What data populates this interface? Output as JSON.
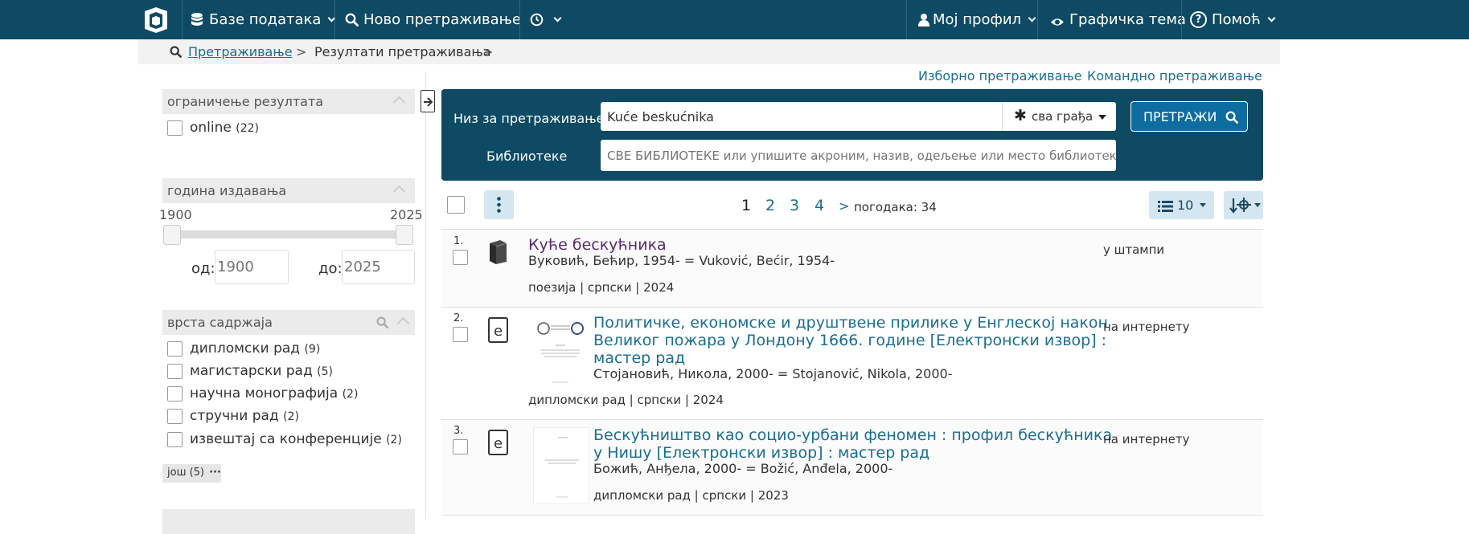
{
  "navbar": {
    "databases_label": "Базе података",
    "new_search_label": "Ново претраживање",
    "profile_label": "Мој профил",
    "theme_label": "Графичка тема",
    "help_label": "Помоћ"
  },
  "breadcrumb": {
    "search_link": "Претраживање",
    "separator": ">",
    "results": "Резултати претраживања"
  },
  "links": {
    "selective_search": "Изборно претраживање",
    "command_search": "Командно претраживање"
  },
  "search": {
    "query_label": "Низ за претраживање",
    "query_value": "Kuće beskućnika",
    "material_select": "сва грађа",
    "libraries_label": "Библиотеке",
    "libraries_placeholder": "СВЕ БИБЛИОТЕКЕ или упишите акроним, назив, одељење или место библиотеке",
    "submit_label": "ПРЕТРАЖИ"
  },
  "facets": {
    "limit": {
      "title": "ограничење резултата",
      "items": [
        {
          "label": "online",
          "count": "(22)"
        }
      ]
    },
    "year": {
      "title": "година издавања",
      "min_label": "1900",
      "max_label": "2025",
      "from_label": "од:",
      "to_label": "до:",
      "from_placeholder": "1900",
      "to_placeholder": "2025"
    },
    "content_type": {
      "title": "врста садржаја",
      "items": [
        {
          "label": "дипломски рад",
          "count": "(9)"
        },
        {
          "label": "магистарски рад",
          "count": "(5)"
        },
        {
          "label": "научна монографија",
          "count": "(2)"
        },
        {
          "label": "стручни рад",
          "count": "(2)"
        },
        {
          "label": "извештај са конференције",
          "count": "(2)"
        }
      ],
      "more_label": "још (5)"
    }
  },
  "pagination": {
    "pages": [
      "1",
      "2",
      "3",
      "4"
    ],
    "current": "1",
    "next": ">",
    "hits_label": "погодака: 34",
    "page_size": "10"
  },
  "results": [
    {
      "num": "1.",
      "title": "Куће бескућника",
      "author": "Вуковић, Бећир, 1954- = Vuković, Bećir, 1954-",
      "meta": "поезија | српски | 2024",
      "availability": "у штампи",
      "icon": "book-icon"
    },
    {
      "num": "2.",
      "title_lines": [
        "Политичке, економске и друштвене прилике у Енглеској након",
        "Великог пожара у Лондону 1666. године [Електронски извор] :",
        "мастер рад"
      ],
      "author": "Стојановић, Никола, 2000- = Stojanović, Nikola, 2000-",
      "meta": "дипломски рад | српски | 2024",
      "availability": "на интернету",
      "icon": "e-resource-icon"
    },
    {
      "num": "3.",
      "title_lines": [
        "Бескућништво као социо-урбани феномен : профил бескућника",
        "у Нишу [Електронски извор] : мастер рад"
      ],
      "author": "Божић, Анђела, 2000- = Božić, Anđela, 2000-",
      "meta": "дипломски рад | српски | 2023",
      "availability": "на интернету",
      "icon": "e-resource-icon"
    }
  ],
  "colors": {
    "navbar": "#0e4a64",
    "link": "#1a6e92",
    "visited_title": "#5a2a6e",
    "light_button": "#d4e6f0"
  }
}
